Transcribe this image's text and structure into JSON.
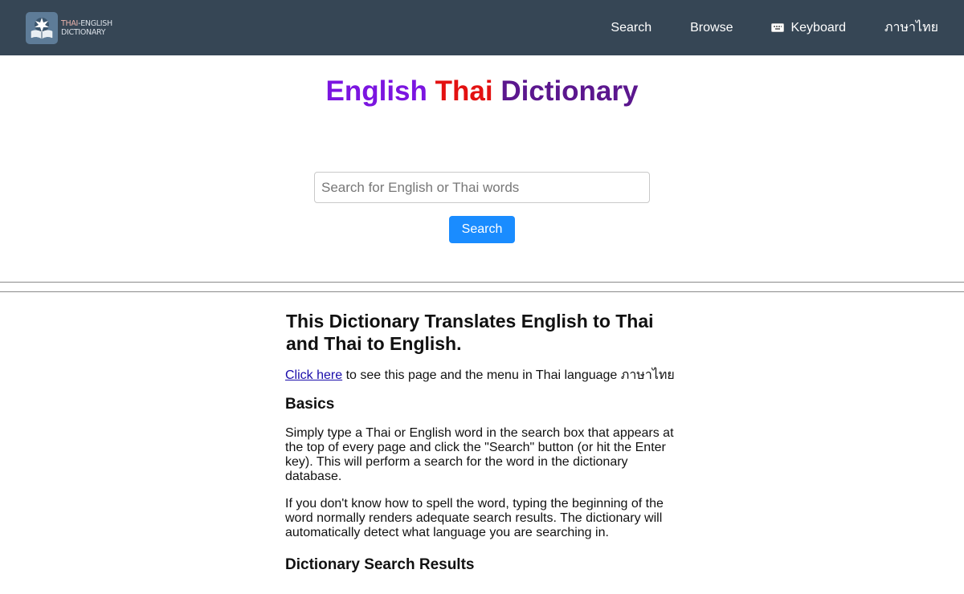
{
  "header": {
    "logo_line1_a": "THAI",
    "logo_line1_b": "-ENGLISH",
    "logo_line2": "DICTIONARY",
    "nav": {
      "search": "Search",
      "browse": "Browse",
      "keyboard": "Keyboard",
      "thai": "ภาษาไทย"
    },
    "background": "#364655"
  },
  "hero": {
    "title_word1": "English",
    "title_word2": "Thai",
    "title_word3": "Dictionary",
    "colors": {
      "word1": "#7b15e0",
      "word2": "#e31111",
      "word3": "#5b178e"
    }
  },
  "search": {
    "placeholder": "Search for English or Thai words",
    "value": "",
    "button_label": "Search",
    "button_color": "#1a8cff"
  },
  "content": {
    "heading": "This Dictionary Translates English to Thai and Thai to English.",
    "link_text": "Click here",
    "link_suffix": " to see this page and the menu in Thai language ภาษาไทย",
    "basics_heading": "Basics",
    "basics_p1": "Simply type a Thai or English word in the search box that appears at the top of every page and click the \"Search\" button (or hit the Enter key). This will perform a search for the word in the dictionary database.",
    "basics_p2": "If you don't know how to spell the word, typing the beginning of the word normally renders adequate search results. The dictionary will automatically detect what language you are searching in.",
    "results_heading": "Dictionary Search Results"
  },
  "icons": {
    "logo": "book-lotus-logo-icon",
    "keyboard": "keyboard-icon"
  }
}
